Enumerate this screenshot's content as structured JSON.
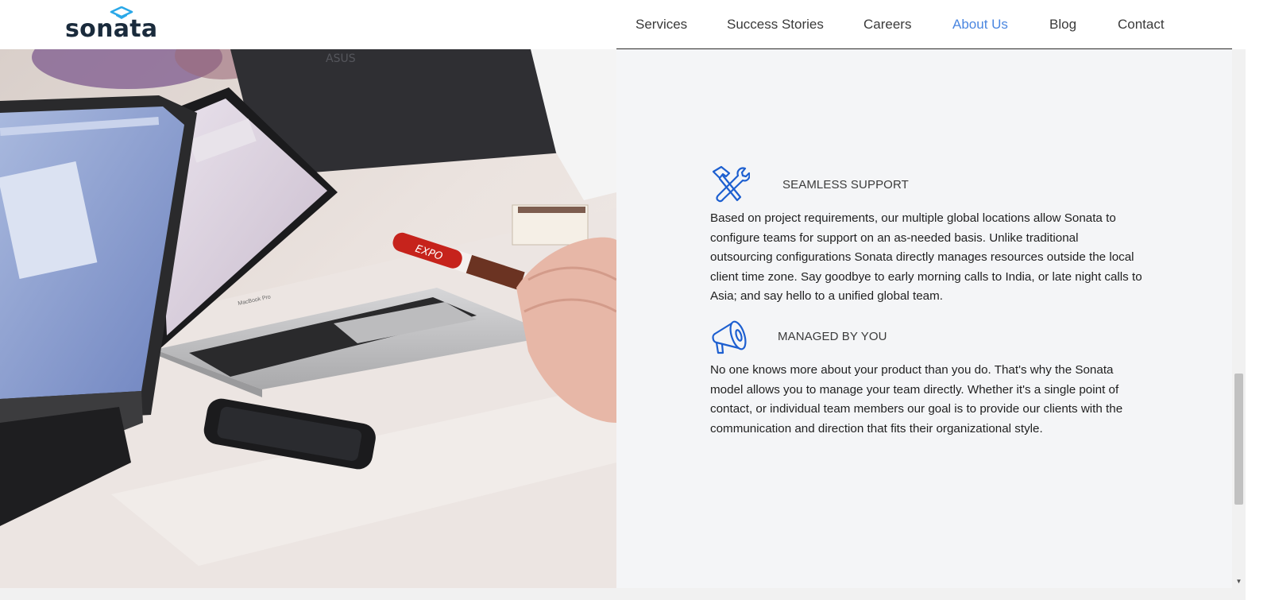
{
  "brand": {
    "name": "sonata",
    "mark_color": "#2aa8e8",
    "text_color": "#1a2b3c"
  },
  "nav": {
    "items": [
      {
        "label": "Services",
        "active": false
      },
      {
        "label": "Success Stories",
        "active": false
      },
      {
        "label": "Careers",
        "active": false
      },
      {
        "label": "About Us",
        "active": true
      },
      {
        "label": "Blog",
        "active": false
      },
      {
        "label": "Contact",
        "active": false
      }
    ],
    "active_color": "#4a86e0"
  },
  "hero_image": {
    "icon": "office-laptops-photo",
    "laptop_brand_text": "MacBook Pro",
    "monitor_brand_text": "ASUS",
    "marker_label": "EXPO"
  },
  "features": [
    {
      "icon": "tools-icon",
      "title": "SEAMLESS SUPPORT",
      "body": "Based on project requirements, our multiple global locations allow Sonata to configure teams for support on an as-needed basis. Unlike traditional outsourcing configurations Sonata directly manages resources outside the local client time zone. Say goodbye to early morning calls to India, or late night calls to Asia; and say hello to a unified global team."
    },
    {
      "icon": "megaphone-icon",
      "title": "MANAGED BY YOU",
      "body": "No one knows more about your product than you do. That's why the Sonata model allows you to manage your team directly. Whether it's a single point of contact, or individual team members our goal is to provide our clients with the communication and direction that fits their organizational style."
    }
  ],
  "colors": {
    "accent_icon": "#1d5fd0",
    "panel_bg": "#f4f5f7"
  }
}
